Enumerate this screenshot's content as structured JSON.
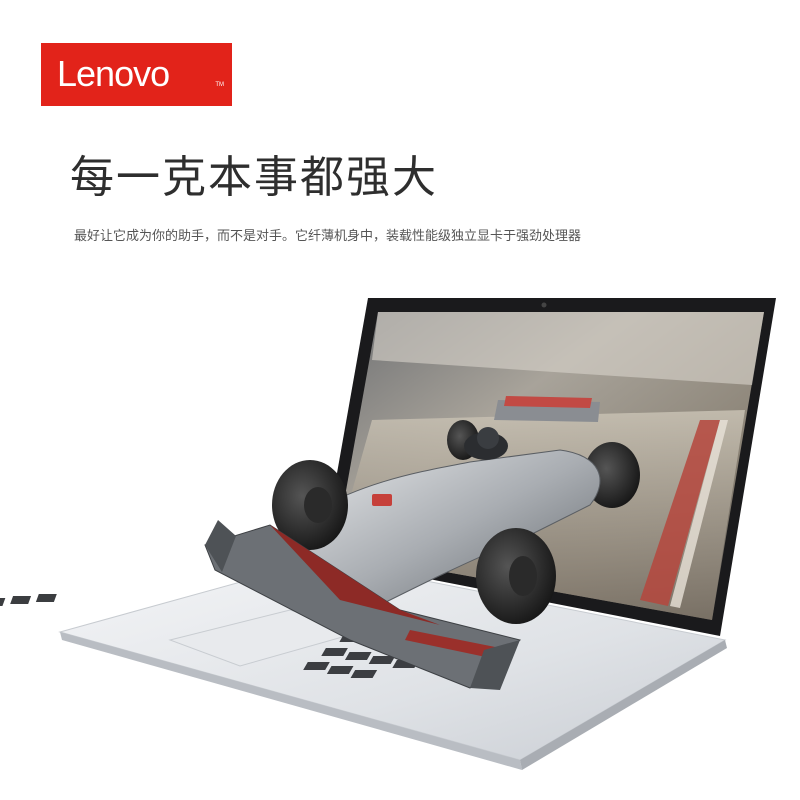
{
  "brand": {
    "name": "Lenovo",
    "trademark": "TM",
    "color": "#e2231a"
  },
  "headline": "每一克本事都强大",
  "subline": "最好让它成为你的助手，而不是对手。它纤薄机身中，装载性能级独立显卡于强劲处理器",
  "hero": {
    "description_icon": "laptop-with-race-car"
  }
}
